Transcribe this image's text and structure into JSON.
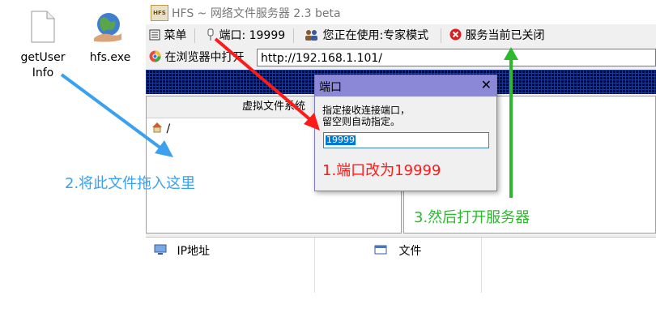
{
  "desktop": {
    "icon1_label_line1": "getUser",
    "icon1_label_line2": "Info",
    "icon2_label": "hfs.exe"
  },
  "window": {
    "logo_text": "HFS",
    "title": "HFS ~ 网络文件服务器 2.3 beta"
  },
  "toolbar": {
    "menu_label": "菜单",
    "port_label": "端口: 19999",
    "mode_label": "您正在使用:专家模式",
    "server_status_label": "服务当前已关闭"
  },
  "address": {
    "open_in_browser_label": "在浏览器中打开",
    "url": "http://192.168.1.101/"
  },
  "vfs": {
    "header": "虚拟文件系统",
    "root": "/"
  },
  "connections": {
    "col_ip": "IP地址",
    "col_file": "文件"
  },
  "dialog": {
    "title": "端口",
    "close": "✕",
    "prompt_line1": "指定接收连接端口，",
    "prompt_line2": "留空则自动指定。",
    "value": "19999"
  },
  "annotations": {
    "step1": "1.端口改为19999",
    "step2": "2.将此文件拖入这里",
    "step3": "3.然后打开服务器"
  },
  "colors": {
    "arrow_red": "#ff1a1a",
    "arrow_blue": "#3aa0f0",
    "arrow_green": "#2db82d",
    "dialog_title": "#8c88d8"
  },
  "icons": [
    "file-icon",
    "globe-hand-icon",
    "hfs-logo-icon",
    "menu-icon",
    "plug-icon",
    "users-icon",
    "stop-icon",
    "browser-icon",
    "home-icon",
    "network-icon",
    "file-list-icon"
  ]
}
